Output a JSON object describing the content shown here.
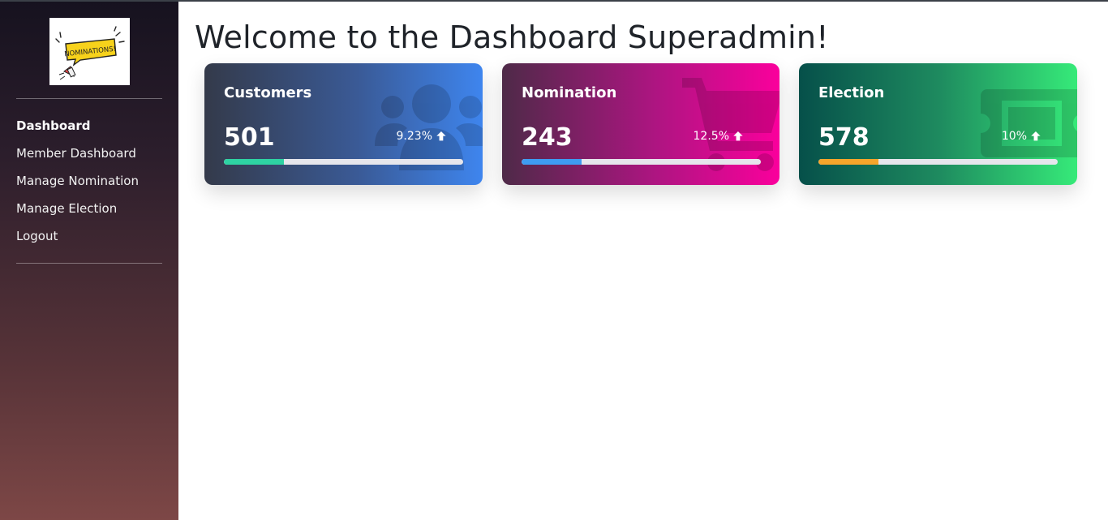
{
  "sidebar": {
    "logo_text": "NOMINATIONS!",
    "items": [
      {
        "label": "Dashboard",
        "active": true
      },
      {
        "label": "Member Dashboard",
        "active": false
      },
      {
        "label": "Manage Nomination",
        "active": false
      },
      {
        "label": "Manage Election",
        "active": false
      },
      {
        "label": "Logout",
        "active": false
      }
    ]
  },
  "main": {
    "title": "Welcome to the Dashboard Superadmin!",
    "cards": [
      {
        "title": "Customers",
        "value": "501",
        "change": "9.23%",
        "progress": 0.25,
        "progress_color": "#2ed3a3",
        "icon": "users-icon"
      },
      {
        "title": "Nomination",
        "value": "243",
        "change": "12.5%",
        "progress": 0.25,
        "progress_color": "#3e9cf2",
        "icon": "cart-icon"
      },
      {
        "title": "Election",
        "value": "578",
        "change": "10%",
        "progress": 0.25,
        "progress_color": "#f6a52b",
        "icon": "ticket-icon"
      }
    ]
  },
  "colors": {
    "title_text": "#1f2329",
    "sidebar_top": "#16121f",
    "sidebar_bottom": "#7d4746"
  }
}
